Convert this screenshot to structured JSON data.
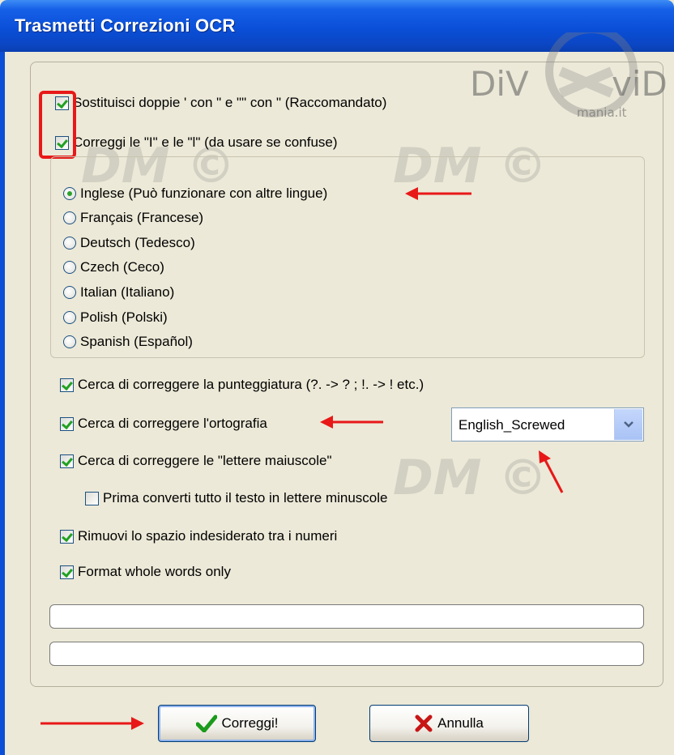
{
  "window": {
    "title": "Trasmetti Correzioni OCR"
  },
  "watermark": {
    "brand_left": "DiV",
    "brand_right": "viD",
    "sub": "mania.it",
    "mark": "DM ©"
  },
  "options": {
    "replace_quotes": {
      "label": "Sostituisci doppie ' con \"  e \"\" con \" (Raccomandato)",
      "checked": true
    },
    "fix_i_l": {
      "label": "Correggi le \"I\" e le \"l\"  (da usare se confuse)",
      "checked": true
    }
  },
  "languages": [
    {
      "label": "Inglese (Può funzionare con altre lingue)",
      "selected": true
    },
    {
      "label": "Français (Francese)",
      "selected": false
    },
    {
      "label": "Deutsch (Tedesco)",
      "selected": false
    },
    {
      "label": "Czech (Ceco)",
      "selected": false
    },
    {
      "label": "Italian (Italiano)",
      "selected": false
    },
    {
      "label": "Polish (Polski)",
      "selected": false
    },
    {
      "label": "Spanish (Español)",
      "selected": false
    }
  ],
  "corrections": {
    "punctuation": {
      "label": "Cerca di correggere la punteggiatura (?. -> ? ; !. -> ! etc.)",
      "checked": true
    },
    "spelling": {
      "label": "Cerca di correggere l'ortografia",
      "checked": true
    },
    "capitals": {
      "label": "Cerca di correggere le \"lettere maiuscole\"",
      "checked": true
    },
    "lowercase_first": {
      "label": "Prima converti tutto il testo in lettere minuscole",
      "checked": false
    },
    "number_spaces": {
      "label": "Rimuovi lo spazio indesiderato tra i numeri",
      "checked": true
    },
    "whole_words": {
      "label": "Format whole words only",
      "checked": true
    }
  },
  "dictionary": {
    "selected": "English_Screwed"
  },
  "buttons": {
    "ok": "Correggi!",
    "cancel": "Annulla"
  },
  "colors": {
    "titlebar": "#0a4fd8",
    "annotation": "#e81818",
    "check": "#21a121"
  }
}
